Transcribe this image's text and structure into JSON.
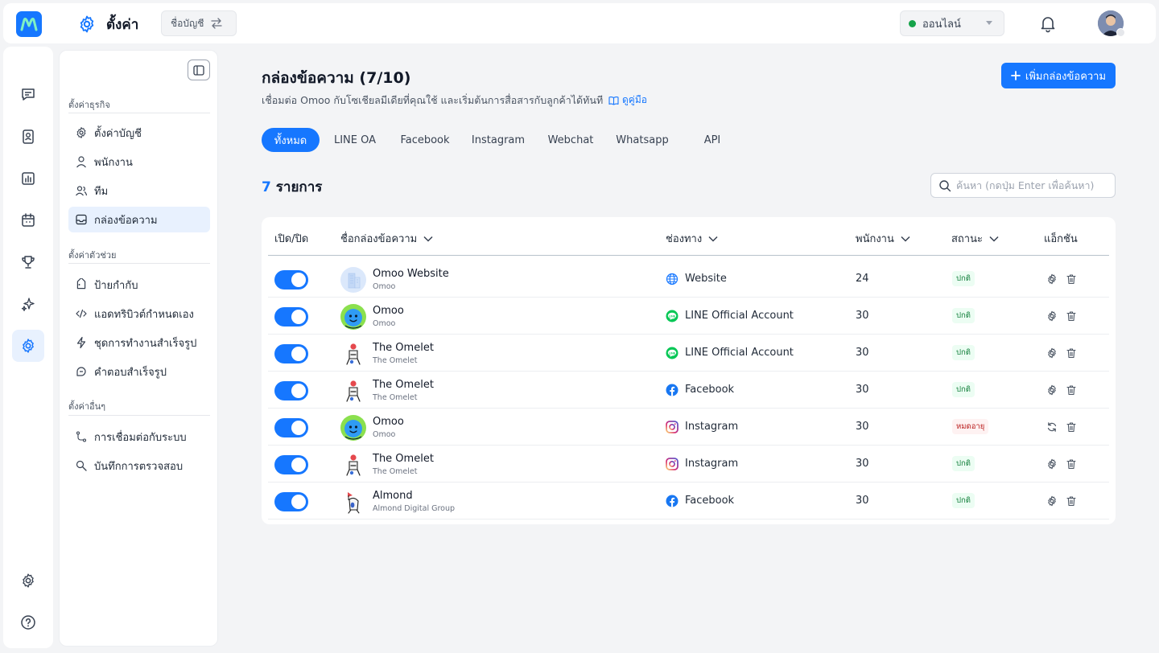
{
  "header": {
    "title": "ตั้งค่า",
    "account_switch_label": "ชื่อบัญชี",
    "status_label": "ออนไลน์",
    "colors": {
      "brand": "#1677ff",
      "online": "#16a34a"
    }
  },
  "sidebar": {
    "sections": [
      {
        "title": "ตั้งค่าธุรกิจ",
        "items": [
          "ตั้งค่าบัญชี",
          "พนักงาน",
          "ทีม",
          "กล่องข้อความ"
        ]
      },
      {
        "title": "ตั้งค่าตัวช่วย",
        "items": [
          "ป้ายกำกับ",
          "แอดทริบิวต์กำหนดเอง",
          "ชุดการทำงานสำเร็จรูป",
          "คำตอบสำเร็จรูป"
        ]
      },
      {
        "title": "ตั้งค่าอื่นๆ",
        "items": [
          "การเชื่อมต่อกับระบบ",
          "บันทึกการตรวจสอบ"
        ]
      }
    ],
    "active_item": "กล่องข้อความ"
  },
  "main": {
    "title": "กล่องข้อความ (7/10)",
    "subtitle": "เชื่อมต่อ Omoo กับโซเชียลมีเดียที่คุณใช้ และเริ่มต้นการสื่อสารกับลูกค้าได้ทันที",
    "guide_label": "ดูคู่มือ",
    "add_button_label": "เพิ่มกล่องข้อความ",
    "tabs": [
      "ทั้งหมด",
      "LINE OA",
      "Facebook",
      "Instagram",
      "Webchat",
      "Whatsapp",
      "API"
    ],
    "active_tab": "ทั้งหมด",
    "count_number": "7",
    "count_label": "รายการ",
    "search_placeholder": "ค้นหา (กดปุ่ม Enter เพื่อค้นหา)"
  },
  "table": {
    "columns": [
      "เปิด/ปิด",
      "ชื่อกล่องข้อความ",
      "ช่องทาง",
      "พนักงาน",
      "สถานะ",
      "แอ็กชัน"
    ],
    "rows": [
      {
        "enabled": true,
        "name": "Omoo Website",
        "sub": "Omoo",
        "avatar": "building-avatar",
        "channel": "Website",
        "channel_icon": "globe-icon",
        "staff": "24",
        "status": "ปกติ",
        "status_type": "ok",
        "action_icon": "gear-icon"
      },
      {
        "enabled": true,
        "name": "Omoo",
        "sub": "Omoo",
        "avatar": "omoo-mascot-avatar",
        "channel": "LINE Official Account",
        "channel_icon": "line-icon",
        "staff": "30",
        "status": "ปกติ",
        "status_type": "ok",
        "action_icon": "gear-icon"
      },
      {
        "enabled": true,
        "name": "The Omelet",
        "sub": "The Omelet",
        "avatar": "omelet-avatar",
        "channel": "LINE Official Account",
        "channel_icon": "line-icon",
        "staff": "30",
        "status": "ปกติ",
        "status_type": "ok",
        "action_icon": "gear-icon"
      },
      {
        "enabled": true,
        "name": "The Omelet",
        "sub": "The Omelet",
        "avatar": "omelet-avatar",
        "channel": "Facebook",
        "channel_icon": "facebook-icon",
        "staff": "30",
        "status": "ปกติ",
        "status_type": "ok",
        "action_icon": "gear-icon"
      },
      {
        "enabled": true,
        "name": "Omoo",
        "sub": "Omoo",
        "avatar": "omoo-mascot-avatar",
        "channel": "Instagram",
        "channel_icon": "instagram-icon",
        "staff": "30",
        "status": "หมดอายุ",
        "status_type": "expired",
        "action_icon": "refresh-icon"
      },
      {
        "enabled": true,
        "name": "The Omelet",
        "sub": "The Omelet",
        "avatar": "omelet-avatar",
        "channel": "Instagram",
        "channel_icon": "instagram-icon",
        "staff": "30",
        "status": "ปกติ",
        "status_type": "ok",
        "action_icon": "gear-icon"
      },
      {
        "enabled": true,
        "name": "Almond",
        "sub": "Almond Digital Group",
        "avatar": "almond-avatar",
        "channel": "Facebook",
        "channel_icon": "facebook-icon",
        "staff": "30",
        "status": "ปกติ",
        "status_type": "ok",
        "action_icon": "gear-icon"
      }
    ]
  }
}
